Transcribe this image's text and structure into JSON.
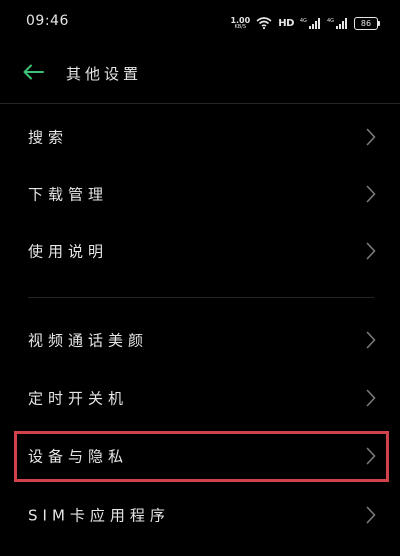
{
  "status_bar": {
    "time": "09:46",
    "net_speed_value": "1.00",
    "net_speed_unit": "KB/S",
    "hd_label": "HD",
    "signal1_tag": "4G",
    "signal2_tag": "4G",
    "battery_level": "86",
    "icons": [
      "wifi-icon",
      "signal-icon",
      "signal-icon",
      "battery-icon"
    ]
  },
  "header": {
    "title": "其他设置",
    "back_icon": "arrow-left-icon"
  },
  "list": {
    "items": [
      {
        "label": "搜索"
      },
      {
        "label": "下载管理"
      },
      {
        "label": "使用说明"
      },
      {
        "label": "视频通话美颜"
      },
      {
        "label": "定时开关机"
      },
      {
        "label": "设备与隐私"
      },
      {
        "label": "SIM卡应用程序"
      }
    ]
  },
  "colors": {
    "background": "#000000",
    "text": "#e6e6e6",
    "accent_back_arrow": "#3fbf7a",
    "chevron": "#7a7a7a",
    "highlight_border": "#d2424a"
  }
}
